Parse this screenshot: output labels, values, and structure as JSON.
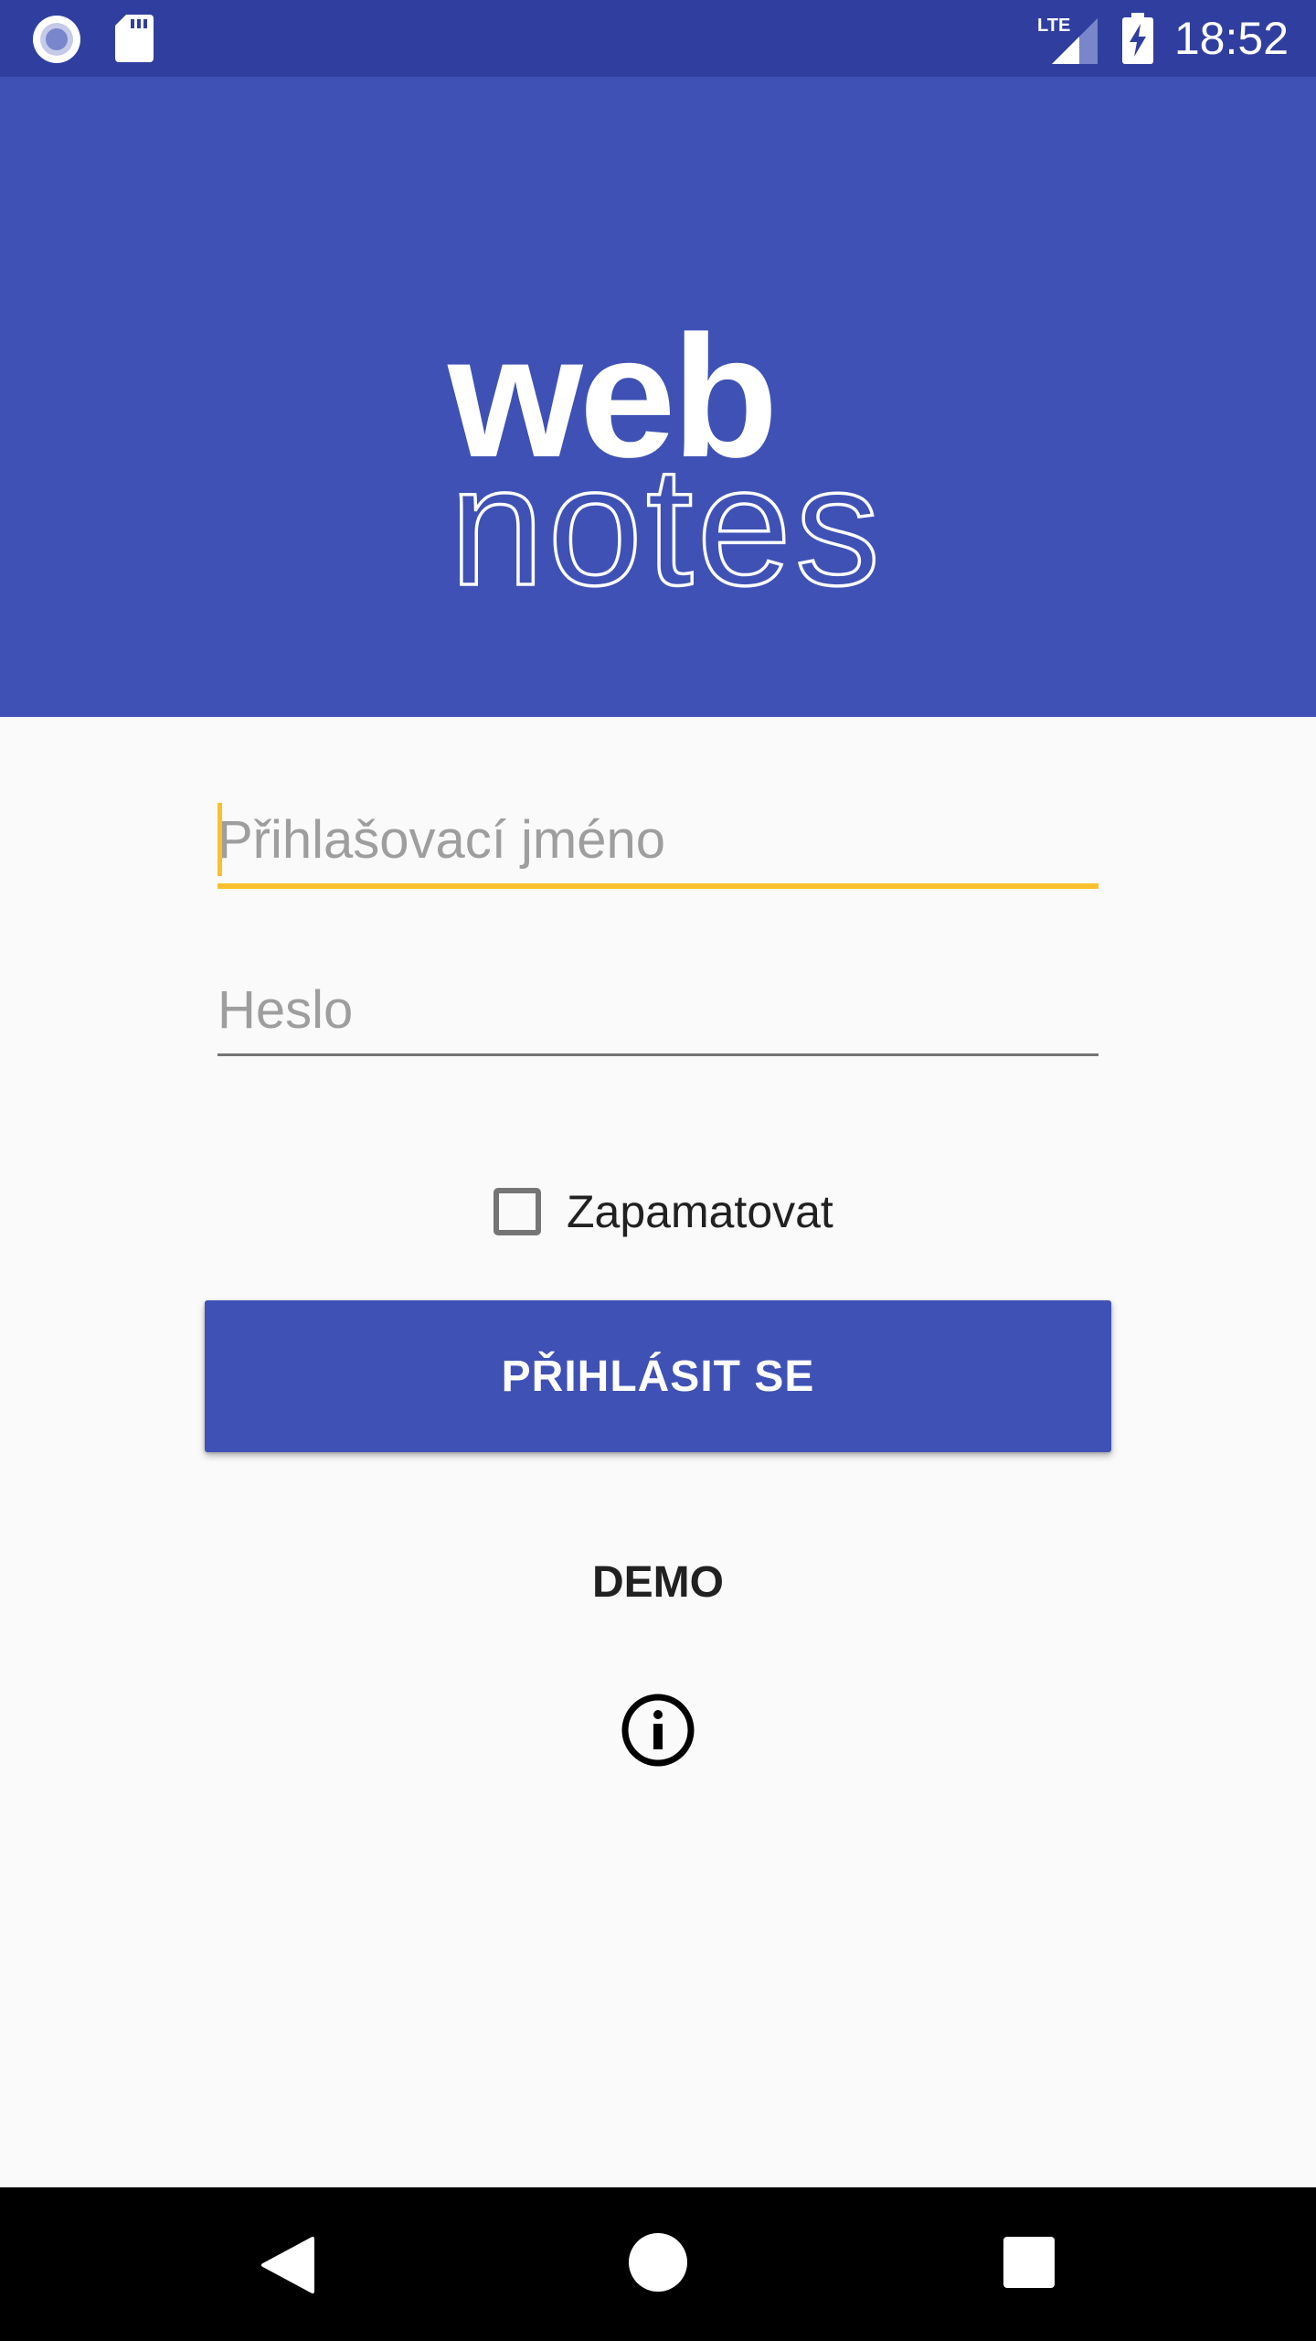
{
  "status_bar": {
    "time": "18:52",
    "network_label": "LTE",
    "icons": [
      "record-icon",
      "sd-card-icon",
      "lte-signal-icon",
      "battery-charging-icon"
    ]
  },
  "header": {
    "logo_line1": "web",
    "logo_line2": "notes",
    "background_color": "#3f51b5"
  },
  "form": {
    "username": {
      "value": "",
      "placeholder": "Přihlašovací jméno"
    },
    "password": {
      "value": "",
      "placeholder": "Heslo"
    },
    "remember_label": "Zapamatovat",
    "remember_checked": false,
    "login_label": "PŘIHLÁSIT SE",
    "demo_label": "DEMO",
    "info_icon": "info-icon"
  },
  "colors": {
    "status_bar": "#303f9f",
    "accent": "#fbc02d",
    "primary": "#3f51b5"
  },
  "nav_bar": {
    "icons": [
      "back-icon",
      "home-icon",
      "recents-icon"
    ]
  }
}
